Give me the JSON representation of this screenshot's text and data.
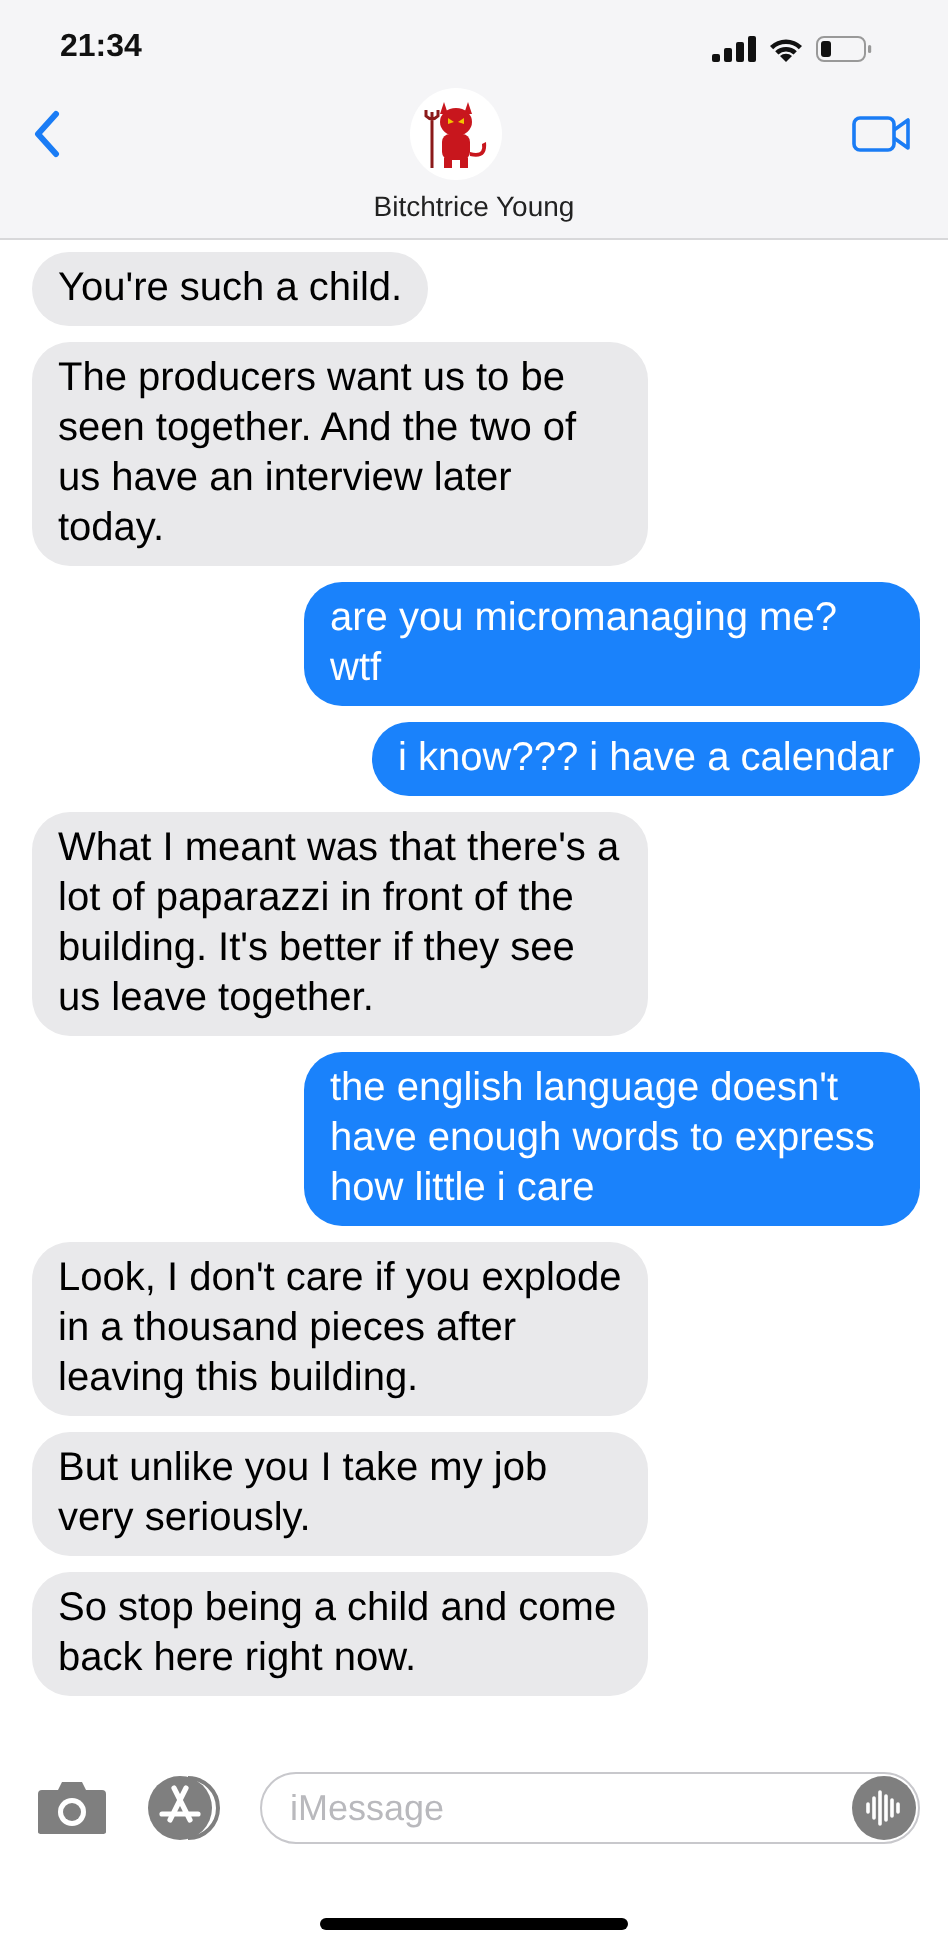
{
  "status_bar": {
    "time": "21:34"
  },
  "header": {
    "contact_name": "Bitchtrice Young"
  },
  "messages": [
    {
      "kind": "received",
      "text": "You're such a child."
    },
    {
      "kind": "received",
      "text": "The producers want us to be seen together. And the two of us have an interview later today."
    },
    {
      "kind": "sent",
      "text": "are you micromanaging me? wtf"
    },
    {
      "kind": "sent",
      "text": "i know??? i have a calendar"
    },
    {
      "kind": "received",
      "text": "What I meant was that there's a lot of paparazzi in front of the building. It's better if they see us leave together."
    },
    {
      "kind": "sent",
      "text": "the english language doesn't have enough words to express how little i care"
    },
    {
      "kind": "received",
      "text": "Look, I don't care if you explode in a thousand pieces after leaving this building."
    },
    {
      "kind": "received",
      "text": "But unlike you I take my job very seriously."
    },
    {
      "kind": "received",
      "text": "So stop being a child and come back here right now."
    }
  ],
  "composer": {
    "placeholder": "iMessage"
  }
}
